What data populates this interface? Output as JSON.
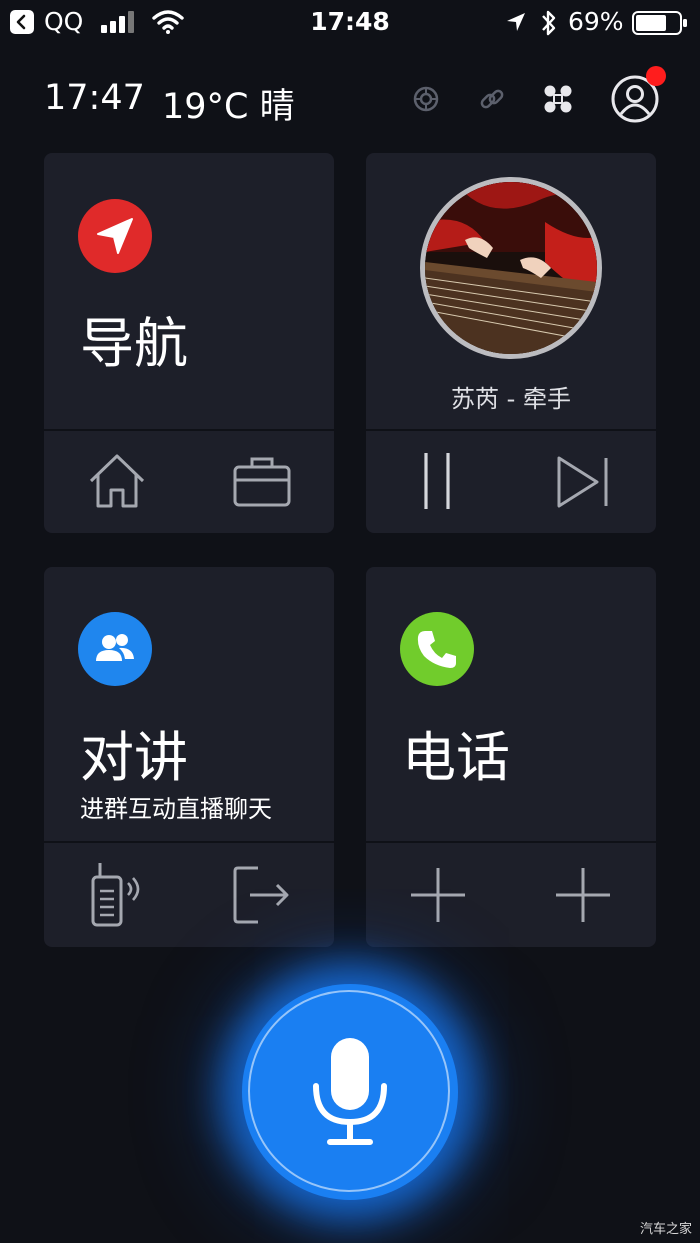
{
  "status_bar": {
    "back_app": "QQ",
    "time": "17:48",
    "battery": "69%"
  },
  "header": {
    "clock": "17:47",
    "weather": "19°C 晴",
    "notification_dot_color": "#ff1d1d"
  },
  "cards": {
    "navigation": {
      "title": "导航",
      "icon": "navigation-arrow-icon",
      "icon_color": "#e02a2a",
      "actions": [
        "home-icon",
        "briefcase-icon"
      ]
    },
    "music": {
      "song": "苏芮 - 牵手",
      "actions": [
        "pause-icon",
        "next-track-icon"
      ]
    },
    "intercom": {
      "title": "对讲",
      "subtitle": "进群互动直播聊天",
      "icon": "group-users-icon",
      "icon_color": "#1f86ee",
      "actions": [
        "walkie-talkie-icon",
        "exit-icon"
      ]
    },
    "phone": {
      "title": "电话",
      "icon": "phone-icon",
      "icon_color": "#71cc2c",
      "actions": [
        "add-icon",
        "add-icon"
      ]
    }
  },
  "voice": {
    "icon": "microphone-icon",
    "color": "#1a7ff2"
  },
  "watermark": "汽车之家"
}
